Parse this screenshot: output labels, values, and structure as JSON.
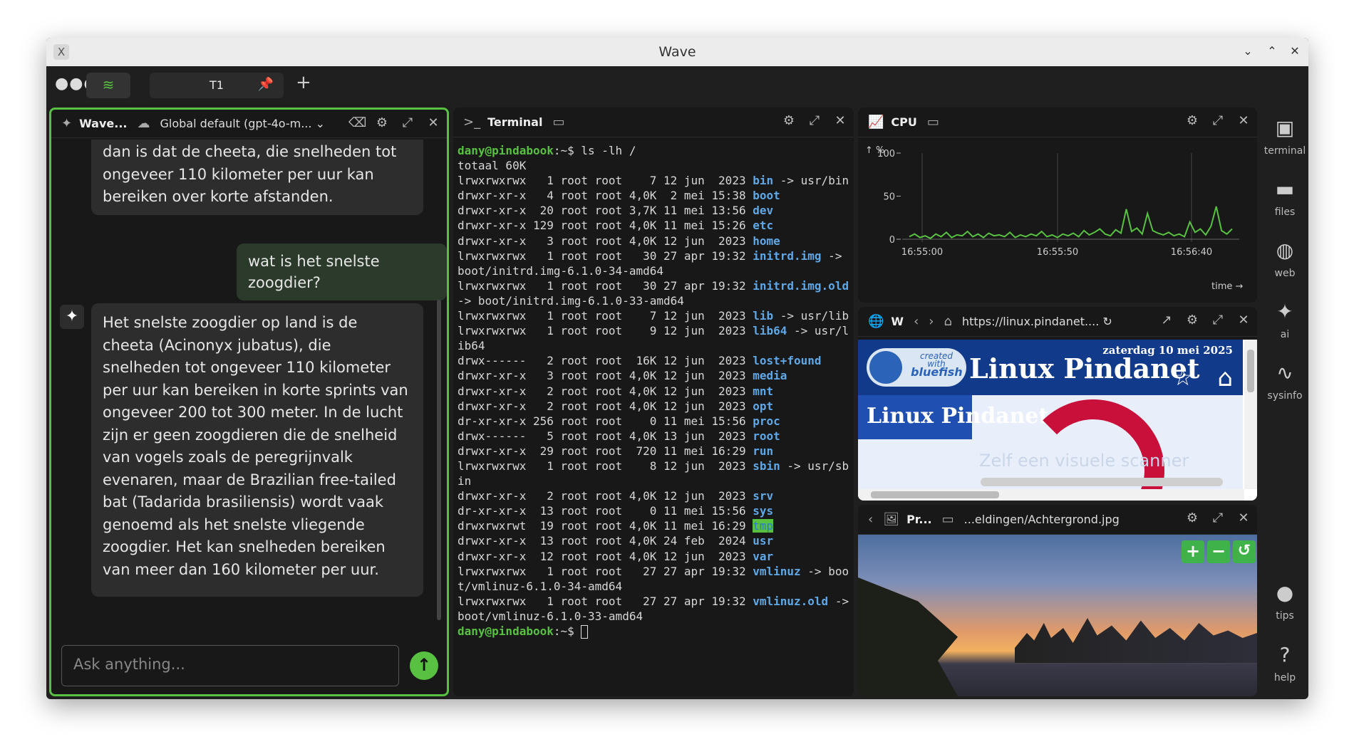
{
  "window": {
    "title": "Wave"
  },
  "tabbar": {
    "tab_label": "T1"
  },
  "ai_block": {
    "title": "Wave...",
    "model": "Global default (gpt-4o-m...",
    "messages": {
      "top_partial": "dan is dat de cheeta, die snelheden tot ongeveer 110 kilometer per uur kan bereiken over korte afstanden.",
      "user": "wat is het snelste zoogdier?",
      "assistant": "Het snelste zoogdier op land is de cheeta (Acinonyx jubatus), die snelheden tot ongeveer 110 kilometer per uur kan bereiken in korte sprints van ongeveer 200 tot 300 meter. In de lucht zijn er geen zoogdieren die de snelheid van vogels zoals de peregrijnvalk evenaren, maar de Brazilian free-tailed bat (Tadarida brasiliensis) wordt vaak genoemd als het snelste vliegende zoogdier. Het kan snelheden bereiken van meer dan 160 kilometer per uur."
    },
    "input_placeholder": "Ask anything..."
  },
  "terminal": {
    "title": "Terminal",
    "prompt": "dany@pindabook",
    "command": ":~$ ls -lh /",
    "total": "totaal 60K",
    "lines": [
      {
        "meta": "lrwxrwxrwx   1 root root    7 12 jun  2023 ",
        "name": "bin",
        "rest": " -> usr/bin"
      },
      {
        "meta": "drwxr-xr-x   4 root root 4,0K  2 mei 15:38 ",
        "name": "boot",
        "rest": ""
      },
      {
        "meta": "drwxr-xr-x  20 root root 3,7K 11 mei 13:56 ",
        "name": "dev",
        "rest": ""
      },
      {
        "meta": "drwxr-xr-x 129 root root 4,0K 11 mei 15:26 ",
        "name": "etc",
        "rest": ""
      },
      {
        "meta": "drwxr-xr-x   3 root root 4,0K 12 jun  2023 ",
        "name": "home",
        "rest": ""
      },
      {
        "meta": "lrwxrwxrwx   1 root root   30 27 apr 19:32 ",
        "name": "initrd.img",
        "rest": " -> boot/initrd.img-6.1.0-34-amd64"
      },
      {
        "meta": "lrwxrwxrwx   1 root root   30 27 apr 19:32 ",
        "name": "initrd.img.old",
        "rest": " -> boot/initrd.img-6.1.0-33-amd64"
      },
      {
        "meta": "lrwxrwxrwx   1 root root    7 12 jun  2023 ",
        "name": "lib",
        "rest": " -> usr/lib"
      },
      {
        "meta": "lrwxrwxrwx   1 root root    9 12 jun  2023 ",
        "name": "lib64",
        "rest": " -> usr/lib64"
      },
      {
        "meta": "drwx------   2 root root  16K 12 jun  2023 ",
        "name": "lost+found",
        "rest": ""
      },
      {
        "meta": "drwxr-xr-x   3 root root 4,0K 12 jun  2023 ",
        "name": "media",
        "rest": ""
      },
      {
        "meta": "drwxr-xr-x   2 root root 4,0K 12 jun  2023 ",
        "name": "mnt",
        "rest": ""
      },
      {
        "meta": "drwxr-xr-x   2 root root 4,0K 12 jun  2023 ",
        "name": "opt",
        "rest": ""
      },
      {
        "meta": "dr-xr-xr-x 256 root root    0 11 mei 15:56 ",
        "name": "proc",
        "rest": ""
      },
      {
        "meta": "drwx------   5 root root 4,0K 13 jun  2023 ",
        "name": "root",
        "rest": ""
      },
      {
        "meta": "drwxr-xr-x  29 root root  720 11 mei 16:29 ",
        "name": "run",
        "rest": ""
      },
      {
        "meta": "lrwxrwxrwx   1 root root    8 12 jun  2023 ",
        "name": "sbin",
        "rest": " -> usr/sbin"
      },
      {
        "meta": "drwxr-xr-x   2 root root 4,0K 12 jun  2023 ",
        "name": "srv",
        "rest": ""
      },
      {
        "meta": "dr-xr-xr-x  13 root root    0 11 mei 15:56 ",
        "name": "sys",
        "rest": ""
      },
      {
        "meta": "drwxrwxrwt  19 root root 4,0K 11 mei 16:29 ",
        "name": "tmp",
        "rest": ""
      },
      {
        "meta": "drwxr-xr-x  13 root root 4,0K 24 feb  2024 ",
        "name": "usr",
        "rest": ""
      },
      {
        "meta": "drwxr-xr-x  12 root root 4,0K 12 jun  2023 ",
        "name": "var",
        "rest": ""
      },
      {
        "meta": "lrwxrwxrwx   1 root root   27 27 apr 19:32 ",
        "name": "vmlinuz",
        "rest": " -> boot/vmlinuz-6.1.0-34-amd64"
      },
      {
        "meta": "lrwxrwxrwx   1 root root   27 27 apr 19:32 ",
        "name": "vmlinuz.old",
        "rest": " -> boot/vmlinuz-6.1.0-33-amd64"
      }
    ],
    "final_prompt": ":~$ "
  },
  "cpu_block": {
    "title": "CPU"
  },
  "chart_data": {
    "type": "line",
    "title": "",
    "ylabel": "↑ %",
    "xlabel": "time →",
    "ylim": [
      0,
      100
    ],
    "yticks": [
      "100",
      "50",
      "0"
    ],
    "xticks": [
      "16:55:00",
      "16:55:50",
      "16:56:40"
    ],
    "series": [
      {
        "values": [
          3,
          6,
          2,
          4,
          1,
          6,
          3,
          8,
          2,
          5,
          4,
          9,
          3,
          6,
          2,
          7,
          4,
          5,
          3,
          8,
          2,
          5,
          3,
          6,
          4,
          9,
          3,
          5,
          2,
          6,
          4,
          7,
          3,
          10,
          5,
          8,
          12,
          6,
          4,
          11,
          7,
          35,
          9,
          13,
          6,
          30,
          10,
          7,
          5,
          8,
          4,
          6,
          3,
          20,
          8,
          12,
          5,
          15,
          38,
          10,
          6,
          12
        ]
      }
    ],
    "color": "#58c142"
  },
  "web_block": {
    "title": "W",
    "url": "https://linux.pindanet....",
    "page": {
      "date": "zaterdag 10 mei 2025",
      "site_title": "Linux Pindanet",
      "logo_line1": "created",
      "logo_line2": "with",
      "logo_line3": "bluefish",
      "banner": "Linux Pindanet",
      "search_hint": "Zelf een visuele scanner"
    }
  },
  "preview_block": {
    "title": "Pr...",
    "path": "...eldingen/Achtergrond.jpg"
  },
  "sidebar": {
    "items": [
      {
        "label": "terminal"
      },
      {
        "label": "files"
      },
      {
        "label": "web"
      },
      {
        "label": "ai"
      },
      {
        "label": "sysinfo"
      },
      {
        "label": "tips"
      },
      {
        "label": "help"
      }
    ]
  }
}
